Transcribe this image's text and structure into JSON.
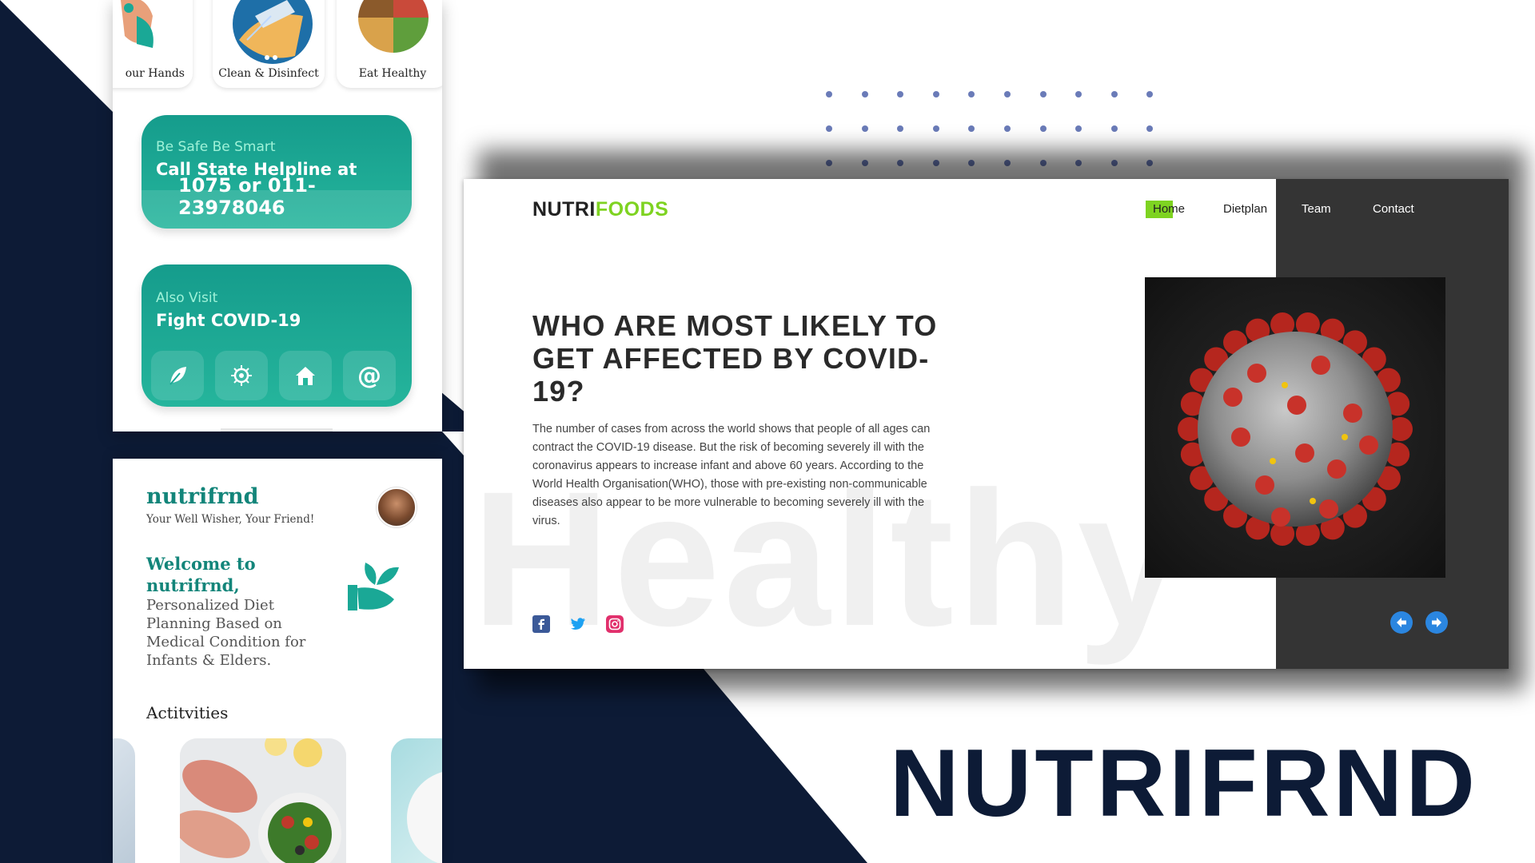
{
  "colors": {
    "navy": "#0d1b36",
    "teal": "#1aa896",
    "accent_green": "#7ed321",
    "dark_panel": "#343434",
    "arrow_blue": "#2b86e0"
  },
  "phone1": {
    "tips": [
      "Wash Your Hands",
      "Clean & Disinfect",
      "Eat Healthy"
    ],
    "tips_visible": [
      "our Hands",
      "Clean & Disinfect",
      "Eat Healthy"
    ],
    "helpline_card": {
      "kicker": "Be Safe Be Smart",
      "title": "Call State Helpline at",
      "number": "1075 or 011-23978046"
    },
    "visit_card": {
      "kicker": "Also Visit",
      "title": "Fight COVID-19",
      "icons": [
        "leaf-icon",
        "virus-icon",
        "home-icon",
        "at-icon"
      ]
    }
  },
  "phone2": {
    "app_name": "nutrifrnd",
    "tagline": "Your Well Wisher, Your Friend!",
    "welcome_title": "Welcome to nutrifrnd,",
    "welcome_body": "Personalized Diet Planning Based on Medical Condition for Infants & Elders.",
    "activities_heading": "Actitvities"
  },
  "desktop": {
    "logo_part1": "NUTRI",
    "logo_part2": "FOODS",
    "nav": [
      "Home",
      "Dietplan",
      "Team",
      "Contact"
    ],
    "headline": "WHO ARE MOST LIKELY TO GET AFFECTED BY COVID-19?",
    "body": "The number of cases from across the world shows that people of all ages can contract the COVID-19 disease. But the risk of becoming severely ill with the coronavirus appears to increase infant and above 60 years. According to the World Health Organisation(WHO), those with pre-existing non-communicable diseases also appear to be more vulnerable to becoming severely ill with the virus.",
    "watermark": "Healthy",
    "social_icons": [
      "facebook-icon",
      "twitter-icon",
      "instagram-icon"
    ]
  },
  "brand_title": "NUTRIFRND"
}
